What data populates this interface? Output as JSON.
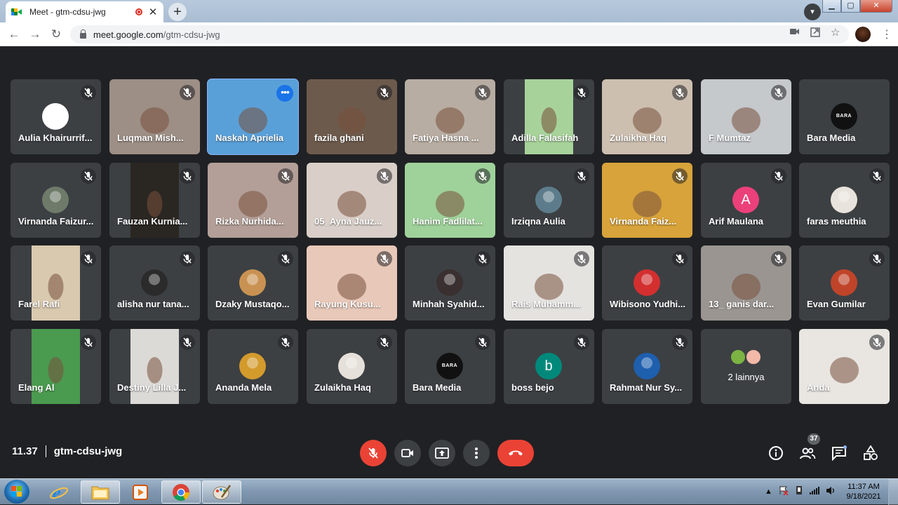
{
  "browser": {
    "tab_title": "Meet - gtm-cdsu-jwg",
    "tab_close": "✕",
    "new_tab": "+",
    "url_host": "meet.google.com",
    "url_path": "/gtm-cdsu-jwg",
    "window_min": "▁",
    "window_max": "▢",
    "window_close": "✕"
  },
  "tiles": [
    {
      "name": "Aulia Khairurrif...",
      "kind": "avatar",
      "color": "#ffffff",
      "muted": true
    },
    {
      "name": "Luqman Mish...",
      "kind": "video",
      "color": "#9d8f86",
      "muted": true
    },
    {
      "name": "Naskah Aprielia",
      "kind": "video",
      "color": "#5aa0d8",
      "muted": false,
      "active": true
    },
    {
      "name": "fazila ghani",
      "kind": "video",
      "color": "#6c5a4c",
      "muted": true
    },
    {
      "name": "Fatiya Hasna ...",
      "kind": "video",
      "color": "#b8ada2",
      "muted": true
    },
    {
      "name": "Adilla Falasifah",
      "kind": "video",
      "color": "#a7d39a",
      "muted": true
    },
    {
      "name": "Zulaikha Haq",
      "kind": "video",
      "color": "#cdbfb0",
      "muted": true
    },
    {
      "name": "F Mumtaz",
      "kind": "video",
      "color": "#c5c9cc",
      "muted": true
    },
    {
      "name": "Bara Media",
      "kind": "avatar",
      "color": "#111111",
      "avatar_text": "BARA",
      "muted": false
    },
    {
      "name": "Virnanda Faizur...",
      "kind": "avatar",
      "color": "#6f7b6a",
      "muted": true
    },
    {
      "name": "Fauzan Kurnia...",
      "kind": "video",
      "color": "#2a2622",
      "muted": true
    },
    {
      "name": "Rizka Nurhida...",
      "kind": "video",
      "color": "#b39f97",
      "muted": true
    },
    {
      "name": "05_Ayna Jauz...",
      "kind": "video",
      "color": "#d9cfc8",
      "muted": true
    },
    {
      "name": "Hanim Fadlilat...",
      "kind": "video",
      "color": "#9fd29a",
      "muted": true
    },
    {
      "name": "Irziqna Aulia",
      "kind": "avatar",
      "color": "#5d7c8b",
      "muted": true
    },
    {
      "name": "Virnanda Faiz...",
      "kind": "video",
      "color": "#d8a33a",
      "muted": true
    },
    {
      "name": "Arif Maulana",
      "kind": "avatar",
      "color": "#ec407a",
      "avatar_text": "A",
      "muted": true
    },
    {
      "name": "faras meuthia",
      "kind": "avatar",
      "color": "#e8e3dc",
      "muted": true
    },
    {
      "name": "Farel Rafi",
      "kind": "video",
      "color": "#d9c9ae",
      "muted": true
    },
    {
      "name": "alisha nur tana...",
      "kind": "avatar",
      "color": "#2b2b2b",
      "muted": true
    },
    {
      "name": "Dzaky Mustaqo...",
      "kind": "avatar",
      "color": "#c99252",
      "muted": true
    },
    {
      "name": "Rayung Kusu...",
      "kind": "video",
      "color": "#e8c8b8",
      "muted": true
    },
    {
      "name": "Minhah Syahid...",
      "kind": "avatar",
      "color": "#3a3030",
      "muted": true
    },
    {
      "name": "Rais Muhamm...",
      "kind": "video",
      "color": "#e5e3e0",
      "muted": true
    },
    {
      "name": "Wibisono Yudhi...",
      "kind": "avatar",
      "color": "#d32f2f",
      "muted": true
    },
    {
      "name": "13_ ganis dar...",
      "kind": "video",
      "color": "#9a9591",
      "muted": true
    },
    {
      "name": "Evan Gumilar",
      "kind": "avatar",
      "color": "#c0442a",
      "muted": true
    },
    {
      "name": "Elang Al",
      "kind": "video",
      "color": "#4a9a4f",
      "muted": true
    },
    {
      "name": "Destiny Lilla J...",
      "kind": "video",
      "color": "#dcdad6",
      "muted": true
    },
    {
      "name": "Ananda Mela",
      "kind": "avatar",
      "color": "#d39a2c",
      "muted": true
    },
    {
      "name": "Zulaikha Haq",
      "kind": "avatar",
      "color": "#e6e0da",
      "muted": true
    },
    {
      "name": "Bara Media",
      "kind": "avatar",
      "color": "#111111",
      "avatar_text": "BARA",
      "muted": true
    },
    {
      "name": "boss bejo",
      "kind": "avatar",
      "color": "#00897b",
      "avatar_text": "b",
      "muted": true
    },
    {
      "name": "Rahmat Nur Sy...",
      "kind": "avatar",
      "color": "#1e5fae",
      "muted": true
    },
    {
      "name": "2 lainnya",
      "kind": "others",
      "color": "#3c4043",
      "muted": false
    },
    {
      "name": "Anda",
      "kind": "video",
      "color": "#e9e6e2",
      "muted": true
    }
  ],
  "meeting": {
    "time": "11.37",
    "code": "gtm-cdsu-jwg",
    "participant_count": "37"
  },
  "taskbar": {
    "clock_time": "11:37 AM",
    "clock_date": "9/18/2021"
  },
  "colors": {
    "hangup": "#ea4335",
    "accent": "#8ab4f8",
    "background": "#202124"
  }
}
